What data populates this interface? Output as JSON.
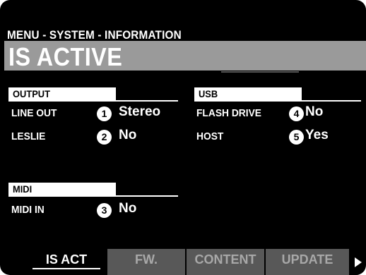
{
  "header": {
    "title": "MENU - SYSTEM - INFORMATION"
  },
  "page": {
    "title": "IS ACTIVE"
  },
  "output": {
    "section_label": "OUTPUT",
    "rows": [
      {
        "label": "LINE OUT",
        "marker": "1",
        "value": "Stereo"
      },
      {
        "label": "LESLIE",
        "marker": "2",
        "value": "No"
      }
    ]
  },
  "usb": {
    "section_label": "USB",
    "rows": [
      {
        "label": "FLASH DRIVE",
        "marker": "4",
        "value": "No"
      },
      {
        "label": "HOST",
        "marker": "5",
        "value": "Yes"
      }
    ]
  },
  "midi": {
    "section_label": "MIDI",
    "rows": [
      {
        "label": "MIDI IN",
        "marker": "3",
        "value": "No"
      }
    ]
  },
  "tabs": [
    {
      "label": "IS ACT",
      "active": true
    },
    {
      "label": "FW.",
      "active": false
    },
    {
      "label": "CONTENT",
      "active": false
    },
    {
      "label": "UPDATE",
      "active": false
    }
  ],
  "icons": {
    "next_page": "triangle-right-icon"
  },
  "colors": {
    "background": "#000000",
    "title_bar": "#9a9a9a",
    "inactive_tab": "#585858",
    "text": "#ffffff"
  }
}
